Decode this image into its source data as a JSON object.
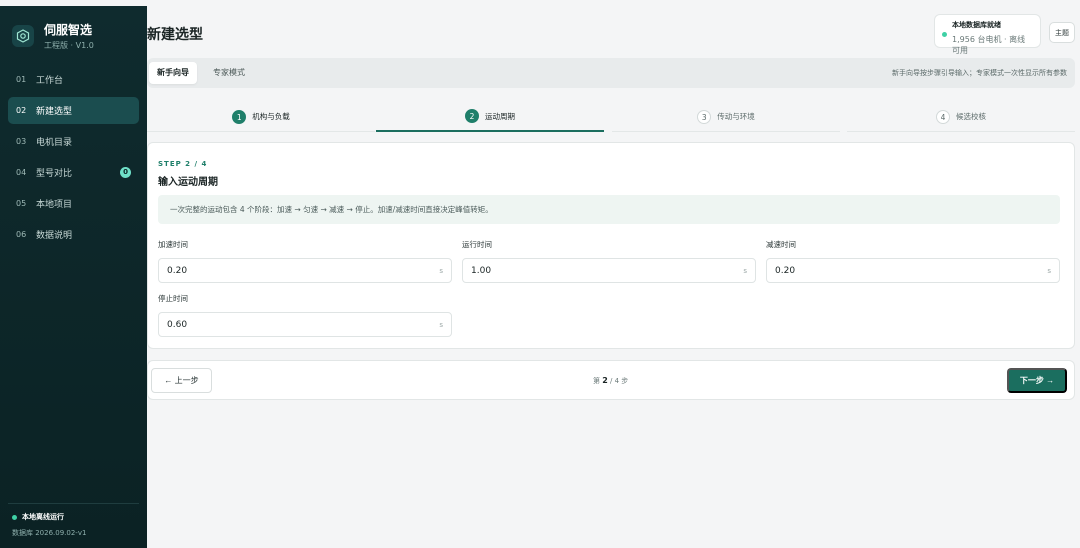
{
  "brand": {
    "name": "伺服智选",
    "subtitle": "工程版 · V1.0"
  },
  "nav": [
    {
      "num": "01",
      "label": "工作台"
    },
    {
      "num": "02",
      "label": "新建选型",
      "active": true
    },
    {
      "num": "03",
      "label": "电机目录"
    },
    {
      "num": "04",
      "label": "型号对比",
      "badge": "0"
    },
    {
      "num": "05",
      "label": "本地项目"
    },
    {
      "num": "06",
      "label": "数据说明"
    }
  ],
  "sidebar_footer": {
    "status": "本地离线运行",
    "db_version": "数据库 2026.09.02-v1"
  },
  "header": {
    "title": "新建选型",
    "db_status_title": "本地数据库就绪",
    "db_status_sub": "1,956 台电机 · 离线可用",
    "theme_label": "主题"
  },
  "tabs": [
    {
      "label": "新手向导",
      "active": true
    },
    {
      "label": "专家模式"
    }
  ],
  "tabs_hint": "新手向导按步骤引导输入；专家模式一次性显示所有参数",
  "steps": [
    {
      "num": "1",
      "label": "机构与负载",
      "state": "done"
    },
    {
      "num": "2",
      "label": "运动周期",
      "state": "active"
    },
    {
      "num": "3",
      "label": "传动与环境",
      "state": "pending"
    },
    {
      "num": "4",
      "label": "候选校核",
      "state": "pending"
    }
  ],
  "form": {
    "kicker": "STEP 2 / 4",
    "title": "输入运动周期",
    "info": "一次完整的运动包含 4 个阶段：加速 → 匀速 → 减速 → 停止。加速/减速时间直接决定峰值转矩。",
    "fields": [
      {
        "label": "加速时间",
        "value": "0.20",
        "unit": "s"
      },
      {
        "label": "运行时间",
        "value": "1.00",
        "unit": "s"
      },
      {
        "label": "减速时间",
        "value": "0.20",
        "unit": "s"
      },
      {
        "label": "停止时间",
        "value": "0.60",
        "unit": "s"
      }
    ]
  },
  "footer": {
    "prev_label": "← 上一步",
    "page_prefix": "第",
    "page_current": "2",
    "page_suffix": "/ 4 步",
    "next_label": "下一步 →"
  }
}
